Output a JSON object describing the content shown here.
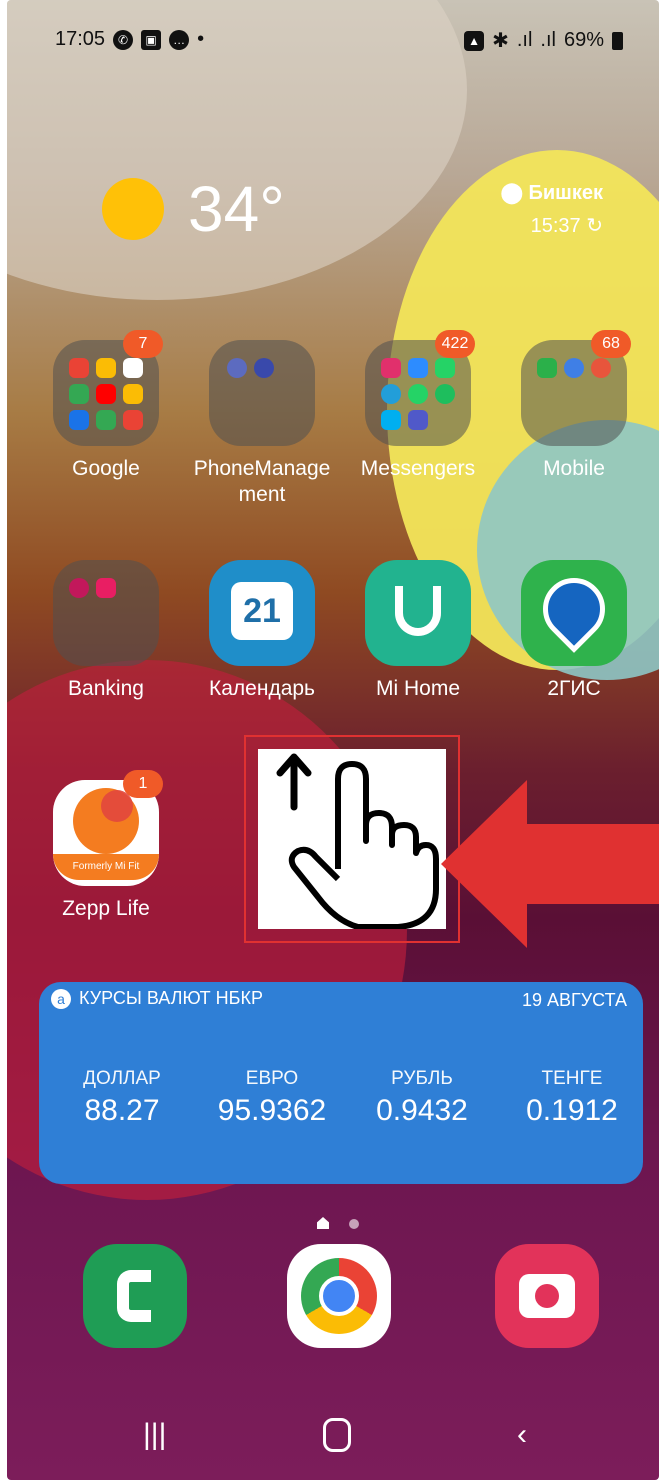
{
  "status_bar": {
    "time": "17:05",
    "battery": "69%"
  },
  "weather": {
    "temperature": "34°",
    "city": "Бишкек",
    "time": "15:37"
  },
  "apps": {
    "google": {
      "label": "Google",
      "badge": "7"
    },
    "phonemanagement": {
      "label": "PhoneManage\nment"
    },
    "messengers": {
      "label": "Messengers",
      "badge": "422"
    },
    "mobile": {
      "label": "Mobile",
      "badge": "68"
    },
    "banking": {
      "label": "Banking"
    },
    "calendar": {
      "label": "Календарь",
      "day": "21"
    },
    "mihome": {
      "label": "Mi Home"
    },
    "twogis": {
      "label": "2ГИС"
    },
    "zepp": {
      "label": "Zepp Life",
      "badge": "1",
      "subtitle": "Formerly Mi Fit"
    }
  },
  "widget": {
    "title": "КУРСЫ ВАЛЮТ НБКР",
    "date": "19 АВГУСТА",
    "currencies": [
      {
        "name": "ДОЛЛАР",
        "value": "88.27"
      },
      {
        "name": "ЕВРО",
        "value": "95.9362"
      },
      {
        "name": "РУБЛЬ",
        "value": "0.9432"
      },
      {
        "name": "ТЕНГЕ",
        "value": "0.1912"
      }
    ]
  },
  "colors": {
    "accent_red": "#e03131",
    "badge": "#f05a28",
    "widget_blue": "#2f7fd6"
  }
}
